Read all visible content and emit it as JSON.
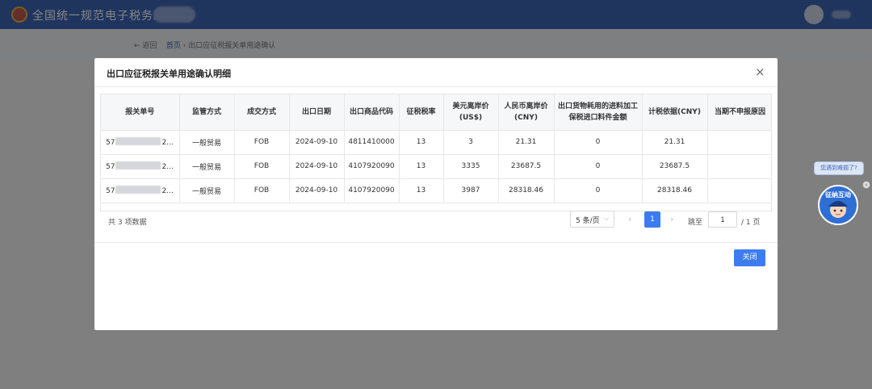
{
  "app": {
    "title": "全国统一规范电子税务局"
  },
  "breadcrumb": {
    "back": "← 返回",
    "home": "首页",
    "separator": "›",
    "current": "出口应征税报关单用途确认"
  },
  "modal": {
    "title": "出口应征税报关单用途确认明细",
    "close_icon": "×",
    "columns": [
      "报关单号",
      "监管方式",
      "成交方式",
      "出口日期",
      "出口商品代码",
      "征税税率",
      "美元离岸价(US$)",
      "人民币离岸价(CNY)",
      "出口货物耗用的进料加工保税进口料件金额",
      "计税依据(CNY)",
      "当期不申报原因"
    ],
    "rows": [
      {
        "decl_prefix": "57",
        "decl_suffix": "2...",
        "supervision": "一般贸易",
        "terms": "FOB",
        "date": "2024-09-10",
        "code": "4811410000",
        "rate": "13",
        "usd": "3",
        "cny": "21.31",
        "material": "0",
        "tax_base": "21.31",
        "reason": ""
      },
      {
        "decl_prefix": "57",
        "decl_suffix": "2...",
        "supervision": "一般贸易",
        "terms": "FOB",
        "date": "2024-09-10",
        "code": "4107920090",
        "rate": "13",
        "usd": "3335",
        "cny": "23687.5",
        "material": "0",
        "tax_base": "23687.5",
        "reason": ""
      },
      {
        "decl_prefix": "57",
        "decl_suffix": "2...",
        "supervision": "一般贸易",
        "terms": "FOB",
        "date": "2024-09-10",
        "code": "4107920090",
        "rate": "13",
        "usd": "3987",
        "cny": "28318.46",
        "material": "0",
        "tax_base": "28318.46",
        "reason": ""
      }
    ],
    "pagination": {
      "total": "共 3 项数据",
      "page_size": "5 条/页",
      "prev": "‹",
      "current_page": "1",
      "next": "›",
      "jump_label": "跳至",
      "jump_value": "1",
      "page_total": "/ 1 页"
    },
    "close_button": "关闭"
  },
  "assistant": {
    "bubble": "您遇到难题了?",
    "badge": "征纳互动"
  },
  "colors": {
    "topbar": "#3f66b4",
    "primary": "#3d7cf0"
  }
}
